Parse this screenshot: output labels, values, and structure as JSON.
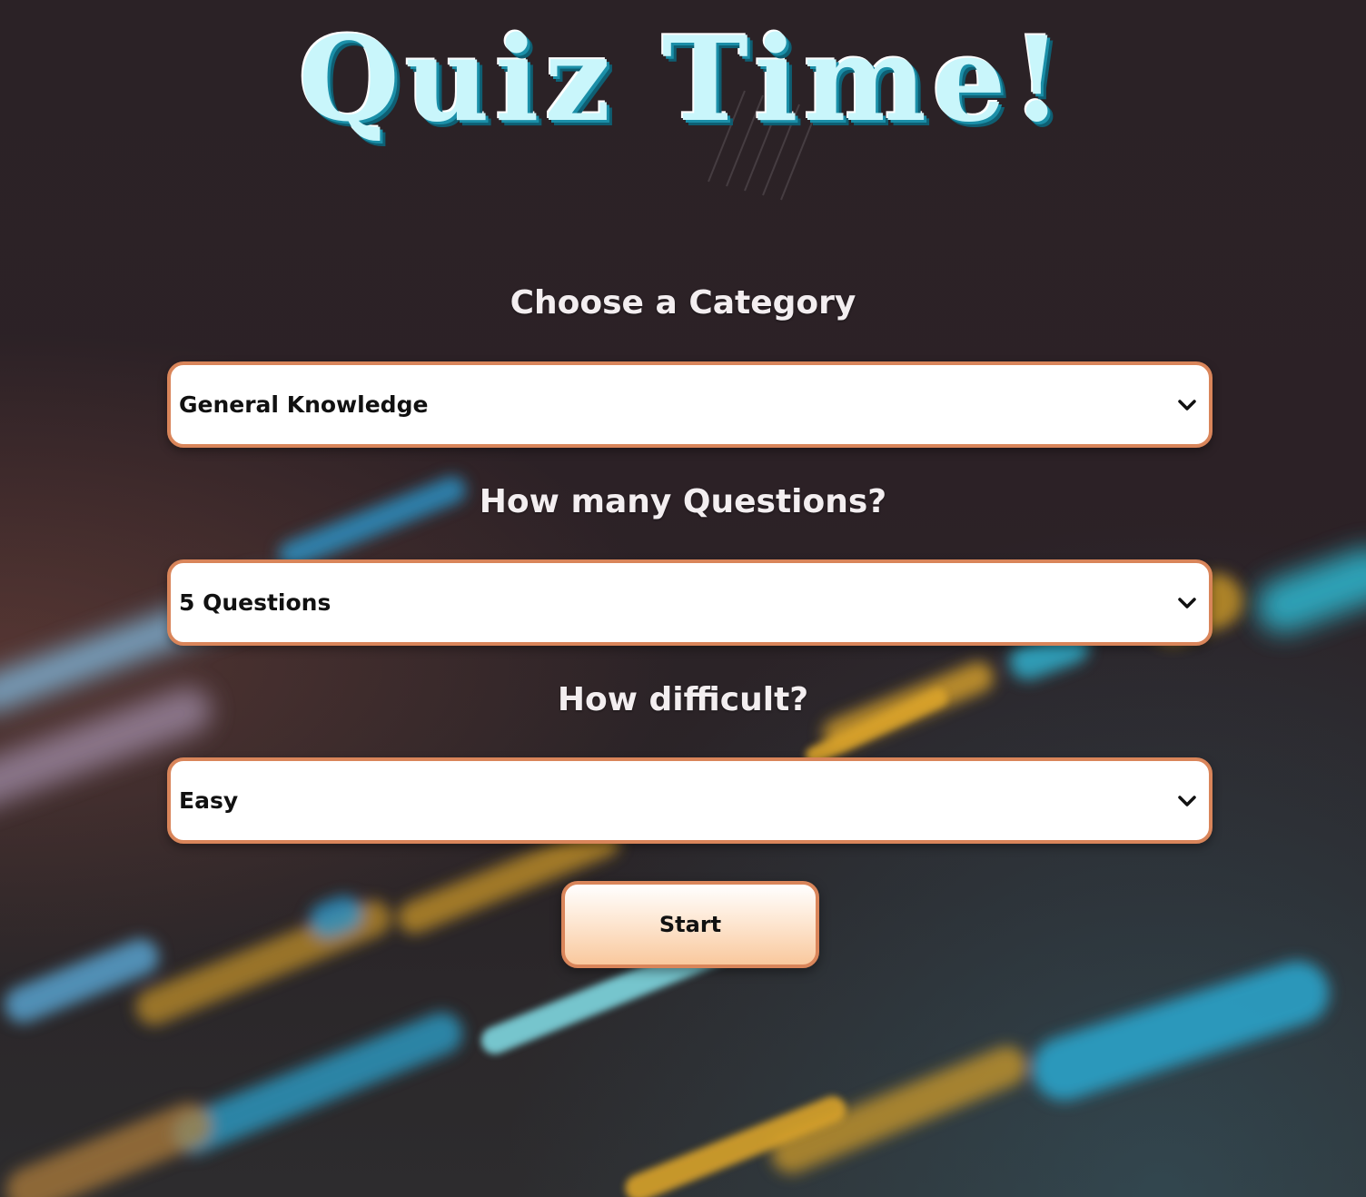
{
  "header": {
    "title": "Quiz Time!"
  },
  "form": {
    "category": {
      "label": "Choose a Category",
      "selected": "General Knowledge"
    },
    "questions": {
      "label": "How many Questions?",
      "selected": "5 Questions"
    },
    "difficulty": {
      "label": "How difficult?",
      "selected": "Easy"
    },
    "start_label": "Start"
  },
  "theme": {
    "title_color": "#c9f6fb",
    "title_shadow": "#1b8fa8",
    "border_accent": "#d9855a",
    "button_gradient_end": "#f9c89d",
    "label_color": "#f3eef0"
  },
  "icons": {
    "select_indicator": "chevron-down-icon"
  }
}
